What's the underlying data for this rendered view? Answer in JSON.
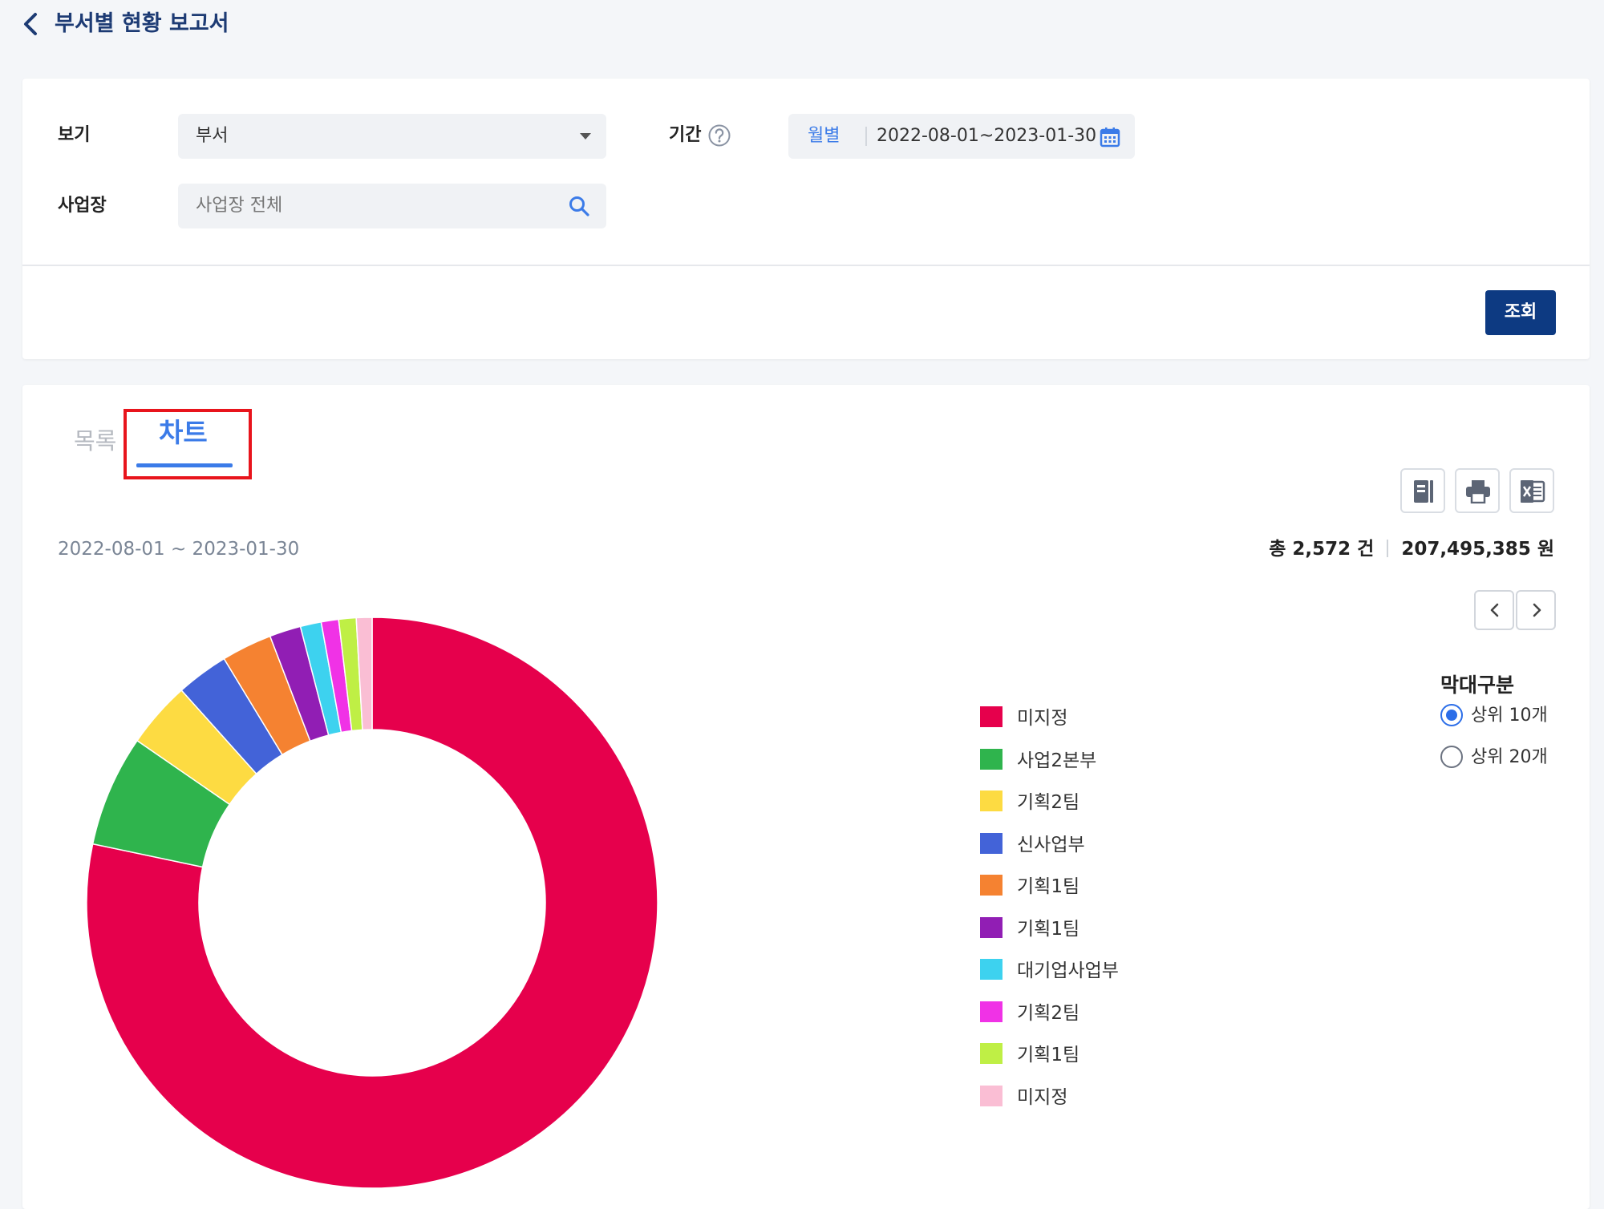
{
  "header": {
    "title": "부서별 현황 보고서"
  },
  "filters": {
    "view_label": "보기",
    "view_value": "부서",
    "period_label": "기간",
    "period_mode": "월별",
    "period_range": "2022-08-01~2023-01-30",
    "site_label": "사업장",
    "site_placeholder": "사업장 전체",
    "search_button": "조회"
  },
  "tabs": {
    "list": "목록",
    "chart": "차트",
    "active": "chart"
  },
  "result": {
    "date_range": "2022-08-01 ~ 2023-01-30",
    "total_count": "총 2,572 건",
    "total_amount": "207,495,385 원"
  },
  "bar_group": {
    "title": "막대구분",
    "options": [
      "상위 10개",
      "상위 20개"
    ],
    "selected": 0
  },
  "chart_data": {
    "type": "pie",
    "donut": true,
    "categories": [
      "미지정",
      "사업2본부",
      "기획2팀",
      "신사업부",
      "기획1팀",
      "기획1팀",
      "대기업사업부",
      "기획2팀",
      "기획1팀",
      "미지정"
    ],
    "values": [
      79.4,
      6.4,
      3.8,
      3.0,
      2.9,
      1.8,
      1.2,
      1.0,
      1.0,
      0.9
    ],
    "colors": [
      "#e6004c",
      "#2fb44d",
      "#fddb42",
      "#4363d8",
      "#f58231",
      "#911eb4",
      "#3dd2ef",
      "#f032e6",
      "#bfef45",
      "#fabed4"
    ],
    "legend_position": "right"
  }
}
